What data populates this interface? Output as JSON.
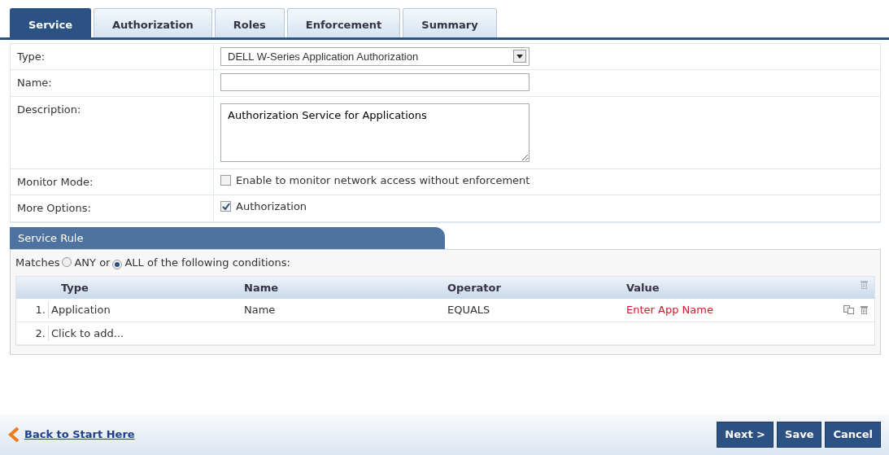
{
  "tabs": [
    {
      "label": "Service",
      "selected": true
    },
    {
      "label": "Authorization",
      "selected": false
    },
    {
      "label": "Roles",
      "selected": false
    },
    {
      "label": "Enforcement",
      "selected": false
    },
    {
      "label": "Summary",
      "selected": false
    }
  ],
  "form": {
    "fields": [
      {
        "kind": "select",
        "label": "Type:",
        "value": "DELL W-Series Application Authorization"
      },
      {
        "kind": "text",
        "label": "Name:"
      },
      {
        "kind": "textarea",
        "label": "Description:",
        "value": "Authorization Service for Applications"
      },
      {
        "kind": "checkbox",
        "label": "Monitor Mode:",
        "option": "Enable to monitor network access without enforcement",
        "checked": false
      },
      {
        "kind": "checkbox",
        "label": "More Options:",
        "option": "Authorization",
        "checked": true
      }
    ]
  },
  "service_rule": {
    "title": "Service Rule",
    "matches_label": "Matches",
    "options": [
      {
        "label": "ANY",
        "selected": false
      },
      {
        "label": "ALL",
        "selected": true
      }
    ],
    "joiner": "or",
    "suffix": "of the following conditions:",
    "columns": [
      "Type",
      "Name",
      "Operator",
      "Value"
    ],
    "rows": [
      {
        "kind": "rule",
        "number": "1.",
        "cells": [
          "Application",
          "Name",
          "EQUALS",
          "Enter App Name"
        ]
      },
      {
        "kind": "add",
        "number": "2.",
        "text": "Click to add..."
      }
    ]
  },
  "footer": {
    "back_link": "Back to Start Here",
    "buttons": [
      "Next >",
      "Save",
      "Cancel"
    ]
  }
}
